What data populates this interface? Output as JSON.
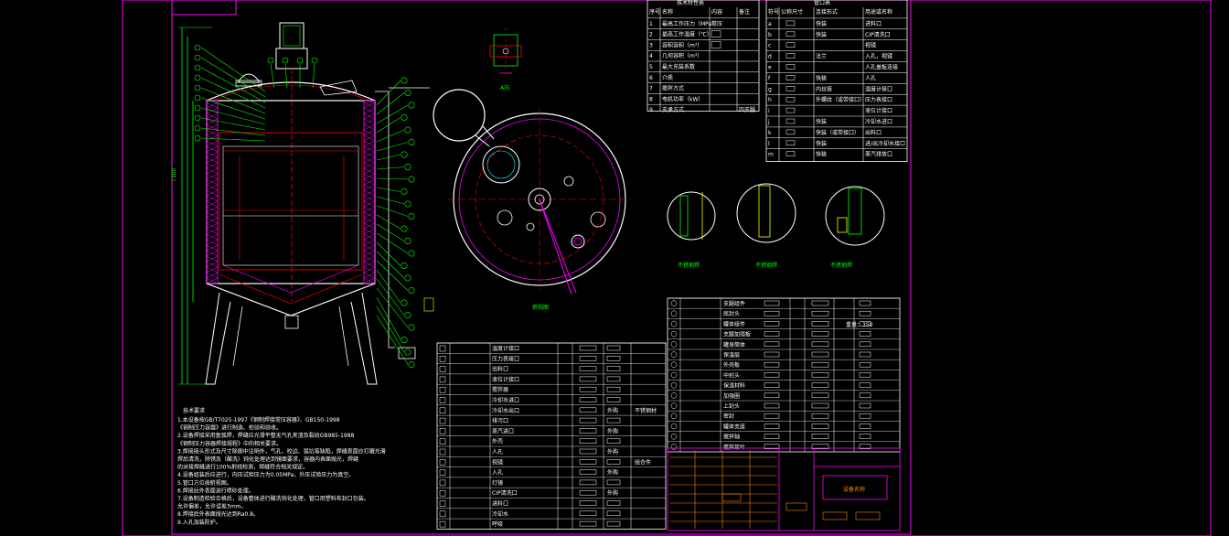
{
  "drawing": {
    "section_label": "A向",
    "plan_label": "俯视图",
    "weld_label": "不锈钢焊",
    "dimension_overall": "7300",
    "weight_label": "重量：350",
    "title_block_name": "设备名称"
  },
  "notes": {
    "heading": "技术要求",
    "lines": [
      "1.本设备按GB/T7025-1997《钢制焊接常压容器》、GB150-1998",
      "  《钢制压力容器》进行制造、检验和验收。",
      "2.设备焊接采用氩弧焊，焊缝应光滑平整无气孔夹渣及裂纹GB985-1988",
      "  《钢制压力容器焊接规程》中的相关要求。",
      "3.焊接接头形式及尺寸除图中注明外，气孔、咬边、弧坑等缺陷，焊缝表面应打磨光滑",
      "  焊后清洗，除锈及（酸洗）钝化处理达到镜面要求，容器内表面抛光，焊缝",
      "  的对接焊缝进行100%射线检测，焊缝符合相关规定。",
      "4.设备组装后应进行，内压试验压力为0.05MPa，外压试验压力为真空。",
      "5.管口方位按俯视图。",
      "6.焊接后外表面进行喷砂处理。",
      "7.设备制造检验合格后，设备整体进行酸洗钝化处理，管口用塑料布封口包装。",
      "  允许偏差，允许误差3mm。",
      "8.焊接后外表面抛光达到Ra0.8。",
      "9.入孔加装防护。"
    ]
  },
  "tech_table": {
    "title": "技术特性表",
    "headers": [
      "序号",
      "名称",
      "内容",
      "备注"
    ],
    "rows": [
      [
        "1",
        "最高工作压力（MPa）",
        "常压",
        ""
      ],
      [
        "2",
        "最高工作温度（℃）",
        "",
        ""
      ],
      [
        "3",
        "容积容积（m³）",
        "",
        ""
      ],
      [
        "4",
        "几何容积（m³）",
        "",
        ""
      ],
      [
        "5",
        "最大充装系数",
        "",
        ""
      ],
      [
        "6",
        "介质",
        "",
        ""
      ],
      [
        "7",
        "搅拌方式",
        "",
        ""
      ],
      [
        "8",
        "电机功率（kW）",
        "",
        ""
      ],
      [
        "9",
        "支承方式",
        "",
        "四支腿"
      ]
    ]
  },
  "nozzle_table": {
    "title": "管口表",
    "headers": [
      "符号",
      "公称尺寸",
      "连接形式",
      "用途或名称"
    ],
    "rows": [
      [
        "a",
        "",
        "快装",
        "进料口"
      ],
      [
        "b",
        "",
        "快装",
        "CIP清洗口"
      ],
      [
        "c",
        "",
        "",
        "视镜"
      ],
      [
        "d",
        "",
        "法兰",
        "入孔，视镜"
      ],
      [
        "e",
        "",
        "",
        "人孔盖板连接"
      ],
      [
        "f",
        "",
        "快装",
        "人孔"
      ],
      [
        "g",
        "",
        "内丝接",
        "温度计接口"
      ],
      [
        "h",
        "",
        "外螺纹（或带接口）",
        "压力表接口"
      ],
      [
        "i",
        "",
        "",
        "液位计接口"
      ],
      [
        "j",
        "",
        "快装",
        "冷却水进口"
      ],
      [
        "k",
        "",
        "快装（或带接口）",
        "出料口"
      ],
      [
        "l",
        "",
        "快装",
        "进/出冷却水接口"
      ],
      [
        "m",
        "",
        "快装",
        "蒸汽排放口"
      ]
    ]
  },
  "parts_upper": {
    "rows": [
      "支腿组件",
      "底封头",
      "罐体组件",
      "支腿加强板",
      "罐身筒体",
      "保温层",
      "外壳板",
      "中封头",
      "保温材料",
      "加强圈",
      "上封头",
      "密封",
      "罐体支座",
      "搅拌轴",
      "搅拌浆叶"
    ]
  },
  "parts_lower": {
    "rows": [
      "温度计接口",
      "压力表接口",
      "出料口",
      "液位计接口",
      "搅拌器",
      "冷却水进口",
      "冷却水出口",
      "排污口",
      "蒸汽进口",
      "外壳",
      "人孔",
      "视镜",
      "入孔",
      "灯镜",
      "CIP清洗口",
      "进料口",
      "冷却水",
      "呼吸"
    ],
    "material_labels": [
      "外购",
      "外购",
      "外购",
      "外购",
      "外购"
    ],
    "note_labels": [
      "不锈钢材",
      "组合件"
    ]
  }
}
